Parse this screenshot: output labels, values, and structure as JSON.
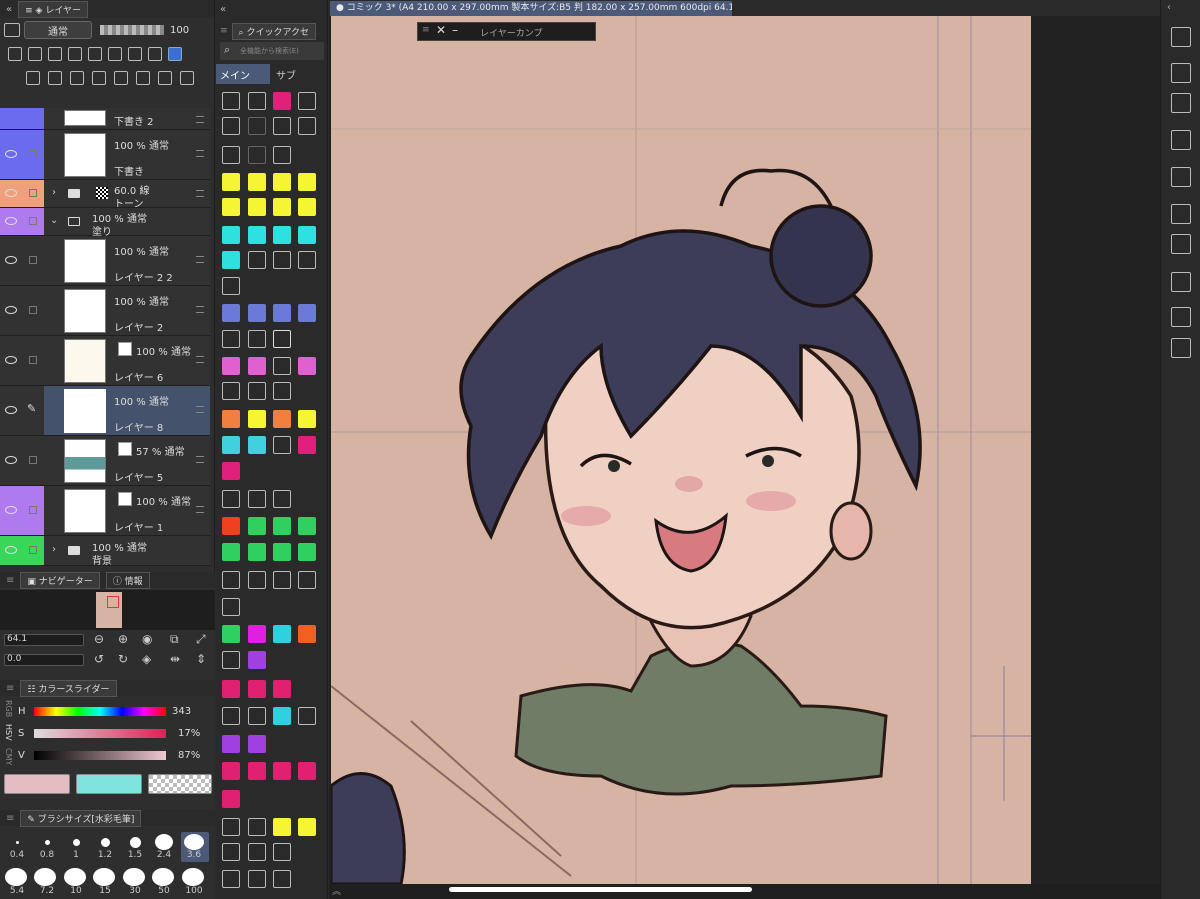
{
  "document_tab": "コミック 3* (A4 210.00 x 297.00mm 製本サイズ:B5 判 182.00 x 257.00mm 600dpi 64.1%)",
  "layer_comp_title": "レイヤーカンプ",
  "layer_panel": {
    "title": "レイヤー",
    "blend_mode": "通常",
    "opacity": "100",
    "layers": [
      {
        "line1": "下書き 2",
        "line2": ""
      },
      {
        "line1": "100 % 通常",
        "line2": "下書き"
      },
      {
        "line1": "60.0 線",
        "line2": "トーン"
      },
      {
        "line1": "100 % 通常",
        "line2": "塗り"
      },
      {
        "line1": "100 % 通常",
        "line2": "レイヤー 2 2"
      },
      {
        "line1": "100 % 通常",
        "line2": "レイヤー 2"
      },
      {
        "line1": "100 % 通常",
        "line2": "レイヤー 6"
      },
      {
        "line1": "100 % 通常",
        "line2": "レイヤー 8"
      },
      {
        "line1": "57 % 通常",
        "line2": "レイヤー 5"
      },
      {
        "line1": "100 % 通常",
        "line2": "レイヤー 1"
      },
      {
        "line1": "100 % 通常",
        "line2": "背景"
      }
    ],
    "colors": {
      "blue": "#6b6bf0",
      "orange": "#f0a07a",
      "purple": "#b07aef",
      "green": "#39d65a",
      "active": "#45526b"
    }
  },
  "navigator": {
    "tab1": "ナビゲーター",
    "tab2": "情報",
    "zoom": "64.1",
    "rotation": "0.0"
  },
  "color_slider": {
    "title": "カラースライダー",
    "mode_labels": [
      "RGB",
      "HSV",
      "CMY"
    ],
    "h_label": "H",
    "h_value": "343",
    "s_label": "S",
    "s_value": "17%",
    "v_label": "V",
    "v_value": "87%",
    "main_color": "#e6bcc4",
    "sub_color": "#7fe3de"
  },
  "brush_size": {
    "title": "ブラシサイズ[水彩毛筆]",
    "sizes_row1": [
      "0.4",
      "0.8",
      "1",
      "1.2",
      "1.5",
      "2.4",
      "3.6"
    ],
    "sizes_row2": [
      "5.4",
      "7.2",
      "10",
      "15",
      "30",
      "50",
      "100"
    ],
    "selected": "3.6"
  },
  "quick_access": {
    "title": "クイックアクセ",
    "search_placeholder": "全機能から検索(E)",
    "tab_main": "メイン",
    "tab_sub": "サブ"
  }
}
